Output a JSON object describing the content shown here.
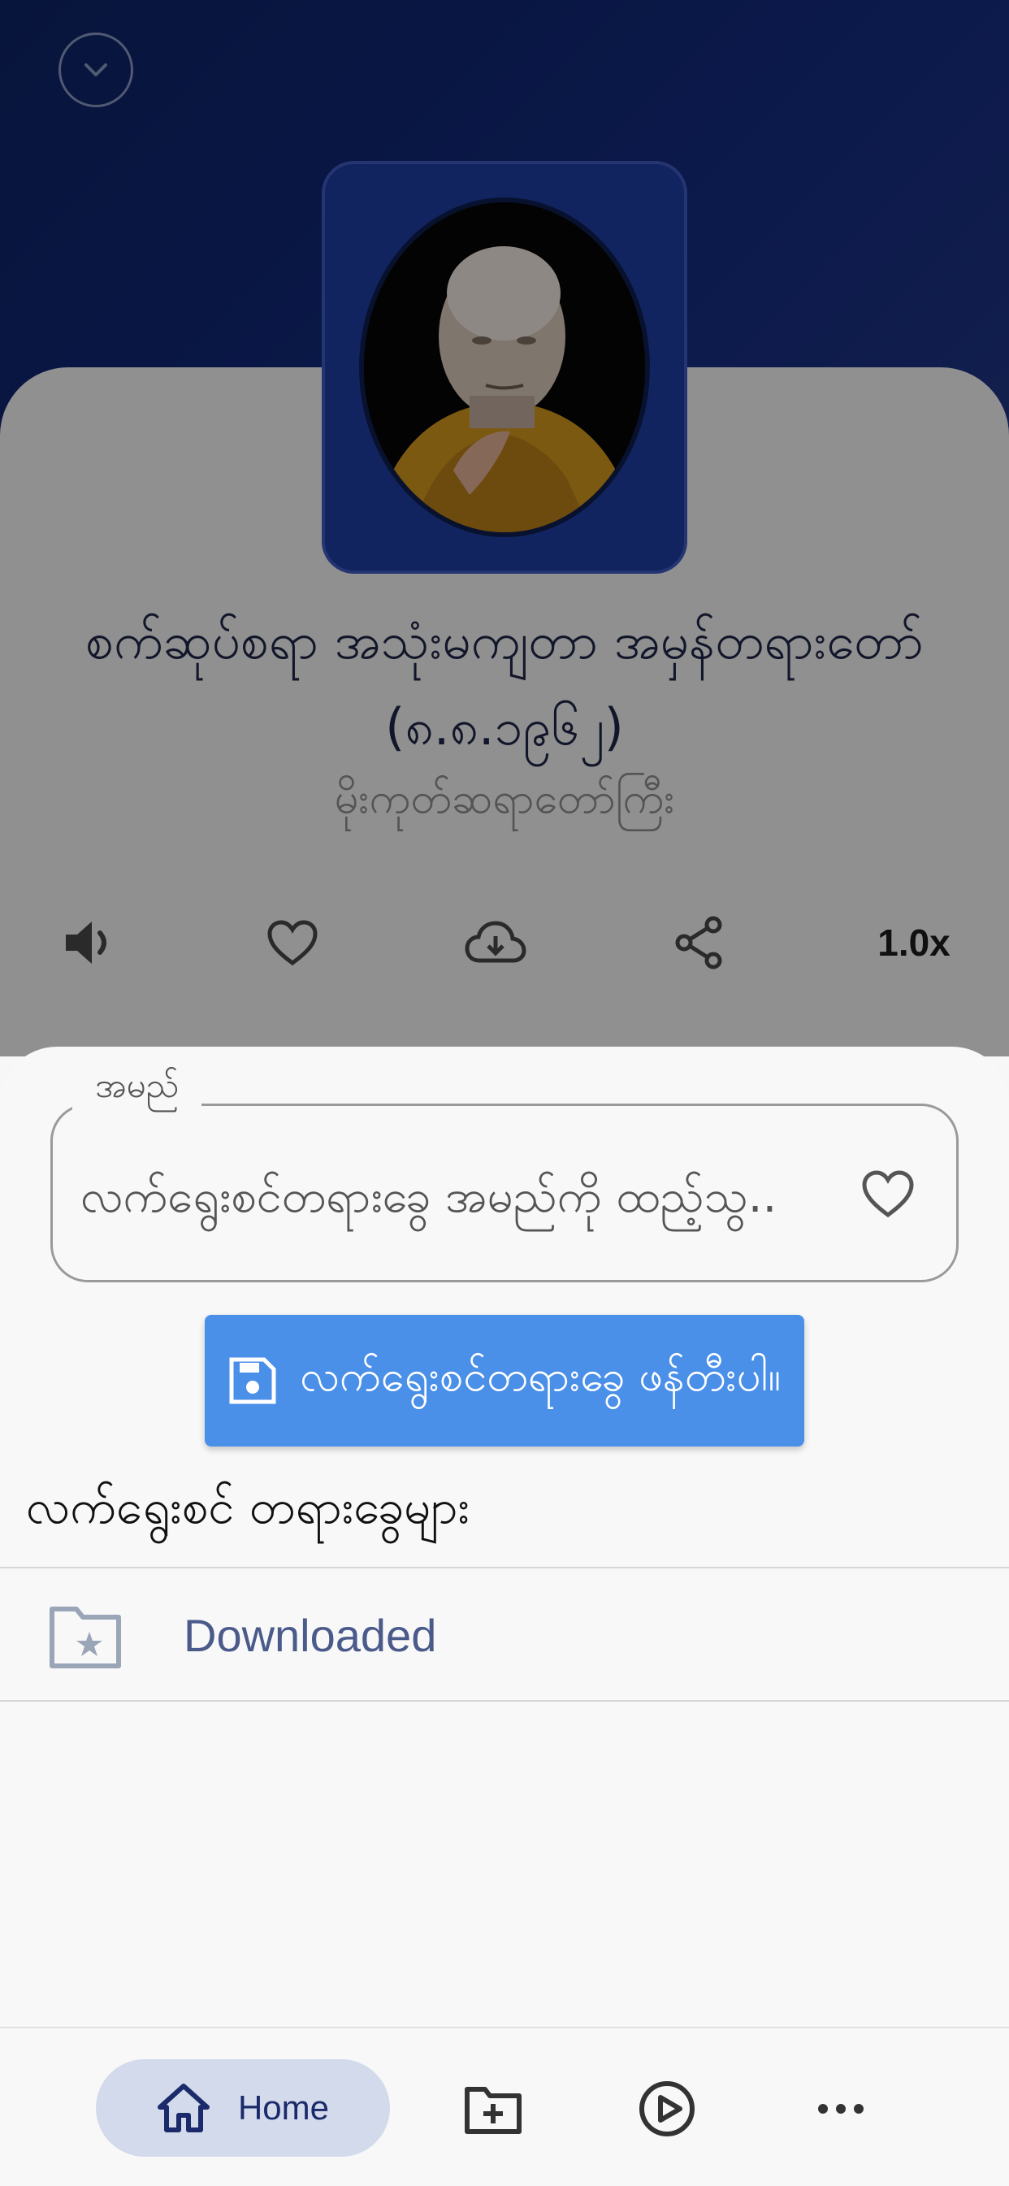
{
  "player": {
    "track_title": "စက်ဆုပ်စရာ အသုံးမကျတာ အမှန်တရားတော် (၈.၈.၁၉၆၂)",
    "track_artist": "မိုးကုတ်ဆရာတော်ကြီး",
    "speed": "1.0x",
    "icons": [
      "chevron-down-icon",
      "volume-icon",
      "heart-icon",
      "cloud-download-icon",
      "share-icon"
    ]
  },
  "sheet": {
    "name_label": "အမည်",
    "name_value": "လက်ရွေးစင်တရားခွေ အမည်ကို ထည့်သွ...",
    "save_label": "လက်ရွေးစင်တရားခွေ ဖန်တီးပါ။",
    "section_title": "လက်ရွေးစင် တရားခွေများ",
    "playlists": [
      {
        "label": "Downloaded",
        "icon": "folder-star-icon"
      }
    ]
  },
  "nav": {
    "home_label": "Home",
    "items": [
      "home-icon",
      "folder-add-icon",
      "play-circle-icon",
      "more-icon"
    ]
  },
  "colors": {
    "accent": "#4a8fe8",
    "player_bg": "#13297a",
    "nav_active": "#d2daeb"
  }
}
